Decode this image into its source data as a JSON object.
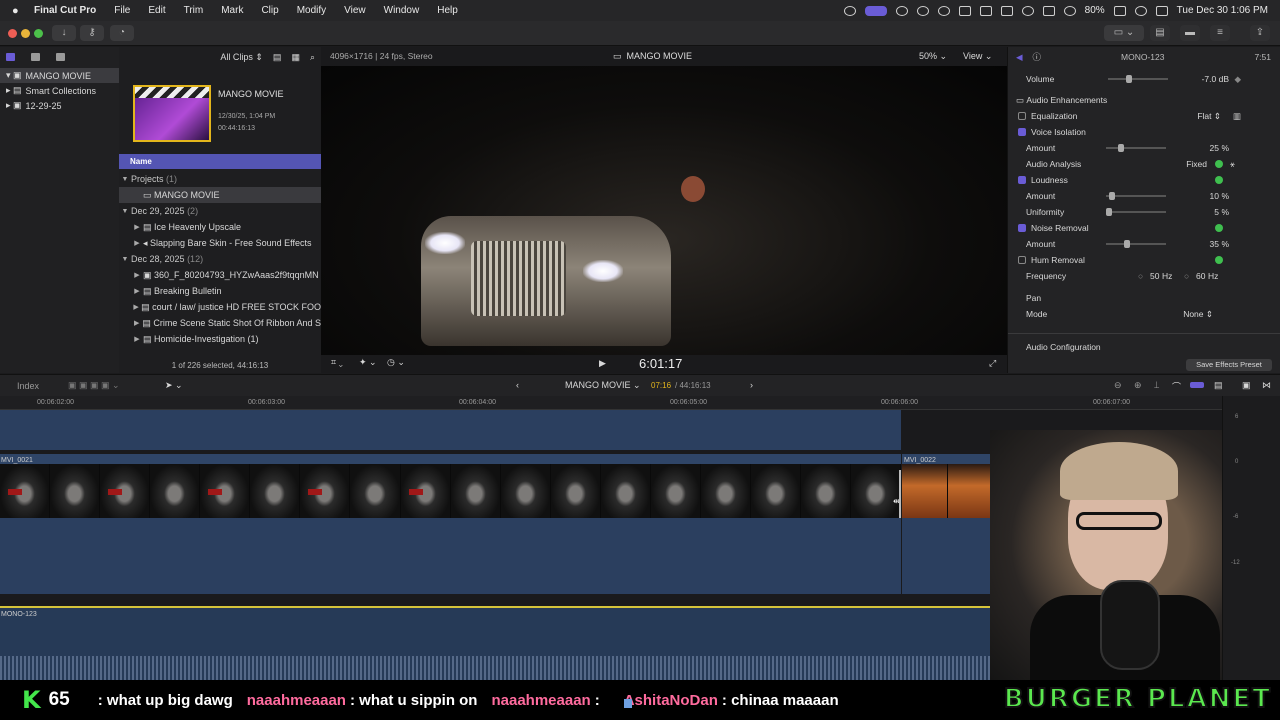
{
  "menubar": {
    "app_name": "Final Cut Pro",
    "items": [
      "File",
      "Edit",
      "Trim",
      "Mark",
      "Clip",
      "Modify",
      "View",
      "Window",
      "Help"
    ],
    "battery": "80%",
    "clock": "Tue Dec 30  1:06 PM"
  },
  "library": {
    "items": [
      {
        "label": "MANGO MOVIE",
        "selected": true
      },
      {
        "label": "Smart Collections"
      },
      {
        "label": "12-29-25"
      }
    ]
  },
  "browser": {
    "filter_label": "All Clips",
    "project_title": "MANGO MOVIE",
    "project_date": "12/30/25, 1:04 PM",
    "project_duration": "00:44:16:13",
    "column_name": "Name",
    "rows": [
      {
        "type": "group",
        "label": "Projects",
        "count": "(1)"
      },
      {
        "type": "item",
        "label": "MANGO MOVIE",
        "selected": true
      },
      {
        "type": "group",
        "label": "Dec 29, 2025",
        "count": "(2)"
      },
      {
        "type": "item",
        "label": "Ice Heavenly Upscale"
      },
      {
        "type": "item",
        "label": "Slapping Bare Skin - Free Sound Effects"
      },
      {
        "type": "group",
        "label": "Dec 28, 2025",
        "count": "(12)"
      },
      {
        "type": "item",
        "label": "360_F_80204793_HYZwAaas2f9tqqnMN"
      },
      {
        "type": "item",
        "label": "Breaking Bulletin"
      },
      {
        "type": "item",
        "label": "court / law/ justice HD FREE STOCK FOO"
      },
      {
        "type": "item",
        "label": "Crime Scene Static Shot Of Ribbon And S"
      },
      {
        "type": "item",
        "label": "Homicide-Investigation (1)"
      }
    ],
    "selection_status": "1 of 226 selected, 44:16:13"
  },
  "viewer": {
    "format": "4096×1716 | 24 fps, Stereo",
    "title": "MANGO MOVIE",
    "zoom": "50%",
    "view_label": "View",
    "timecode": "6:01:17"
  },
  "inspector": {
    "clip_name": "MONO-123",
    "clip_duration": "7:51",
    "volume_label": "Volume",
    "volume_value": "-7.0 dB",
    "section_title": "Audio Enhancements",
    "equalization_label": "Equalization",
    "equalization_value": "Flat",
    "voice_isolation_label": "Voice Isolation",
    "vi_amount_label": "Amount",
    "vi_amount": "25",
    "vi_amount_fraction": 0.25,
    "audio_analysis_label": "Audio Analysis",
    "audio_analysis_value": "Fixed",
    "loudness_label": "Loudness",
    "loud_amount_label": "Amount",
    "loud_amount": "10",
    "loud_amount_fraction": 0.1,
    "uniformity_label": "Uniformity",
    "uniformity": "5",
    "uniformity_fraction": 0.05,
    "noise_removal_label": "Noise Removal",
    "noise_amount_label": "Amount",
    "noise_amount": "35",
    "noise_amount_fraction": 0.35,
    "hum_removal_label": "Hum Removal",
    "frequency_label": "Frequency",
    "freq_50": "50",
    "freq_60": "60",
    "hz_unit": "Hz",
    "percent_unit": "%",
    "pan_label": "Pan",
    "mode_label": "Mode",
    "mode_value": "None",
    "audio_config_label": "Audio Configuration",
    "save_preset_label": "Save Effects Preset"
  },
  "timeline": {
    "index_label": "Index",
    "project_name": "MANGO MOVIE",
    "position": "07:16",
    "total": "44:16:13",
    "ruler_labels": [
      "00:06:02:00",
      "00:06:03:00",
      "00:06:04:00",
      "00:06:05:00",
      "00:06:06:00",
      "00:06:07:00"
    ],
    "clip_a": "MVI_0021",
    "clip_b": "MVI_0022",
    "audio_clip": "MONO-123",
    "meter_labels": [
      "6",
      "0",
      "-6",
      "-12"
    ]
  },
  "overlay": {
    "kick_logo": "K",
    "viewer_count": "65",
    "chat": [
      {
        "user": "",
        "text": ": what up big dawg"
      },
      {
        "user": "naaahmeaaan",
        "text": ": what u sippin on"
      },
      {
        "user": "naaahmeaaan",
        "text": ":"
      },
      {
        "user": "AshitaNoDan",
        "text": ": chinaa maaaan"
      }
    ],
    "brand": "BURGER PLANET"
  },
  "colors": {
    "accent": "#6a5cd6",
    "timeline_blue": "#2b3f5f",
    "kick_green": "#43e64b",
    "chat_user": "#ff6b9e"
  }
}
